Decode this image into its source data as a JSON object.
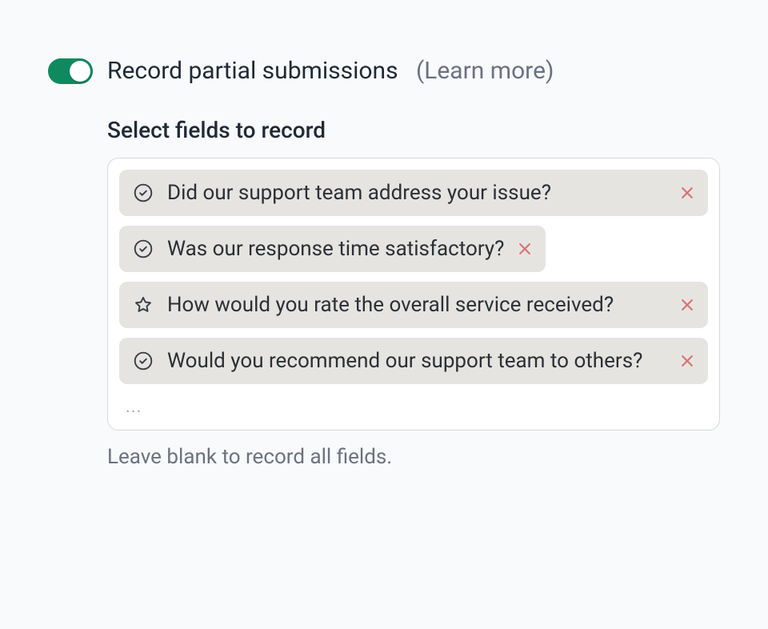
{
  "setting": {
    "title": "Record partial submissions",
    "learn_more": "(Learn more)",
    "enabled": true
  },
  "section": {
    "subtitle": "Select fields to record",
    "help_text": "Leave blank to record all fields.",
    "ellipsis": "..."
  },
  "fields": [
    {
      "icon": "check-circle",
      "label": "Did our support team address your issue?"
    },
    {
      "icon": "check-circle",
      "label": "Was our response time satisfactory?"
    },
    {
      "icon": "star",
      "label": "How would you rate the overall service received?"
    },
    {
      "icon": "check-circle",
      "label": "Would you recommend our support team to others?"
    }
  ]
}
